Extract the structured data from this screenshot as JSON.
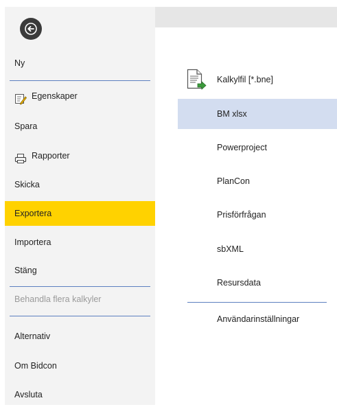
{
  "sidebar": {
    "back_icon": "arrow-left-icon",
    "items": {
      "ny": "Ny",
      "egenskaper": "Egenskaper",
      "spara": "Spara",
      "rapporter": "Rapporter",
      "skicka": "Skicka",
      "exportera": "Exportera",
      "importera": "Importera",
      "stang": "Stäng",
      "behandla": "Behandla flera kalkyler",
      "alternativ": "Alternativ",
      "om_bidcon": "Om Bidcon",
      "avsluta": "Avsluta"
    },
    "active_item": "Exportera",
    "active_color": "#ffd200"
  },
  "export_options": {
    "kalkylfil": "Kalkylfil [*.bne]",
    "bm_xlsx": "BM xlsx",
    "powerproject": "Powerproject",
    "plancon": "PlanCon",
    "prisforfragan": "Prisförfrågan",
    "sbxml": "sbXML",
    "resursdata": "Resursdata",
    "anvandarinstallningar": "Användarinställningar",
    "selected": "BM xlsx",
    "selected_color": "#d3ddf0"
  },
  "colors": {
    "separator": "#5b7fbf",
    "sidebar_bg": "#f3f3f3"
  }
}
